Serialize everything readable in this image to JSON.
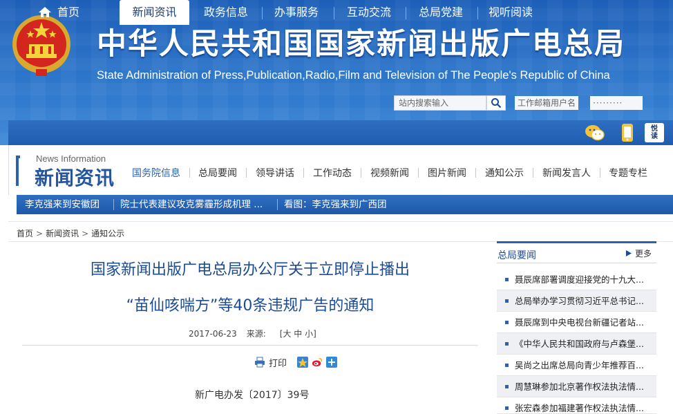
{
  "header": {
    "site_title": "中华人民共和国国家新闻出版广电总局",
    "site_subtitle": "State Administration of Press,Publication,Radio,Film and Television of The People's Republic of China",
    "search_placeholder": "站内搜索输入",
    "username_placeholder": "工作邮箱用户名",
    "password_value": "·········",
    "brand_color": "#2a62b0"
  },
  "nav": {
    "items": [
      "首页",
      "新闻资讯",
      "政务信息",
      "办事服务",
      "互动交流",
      "总局党建",
      "视听阅读"
    ],
    "active": "新闻资讯",
    "icons": [
      "wechat-icon",
      "mobile-icon",
      "yuedu-icon"
    ],
    "yuedu_text": "悦读"
  },
  "section": {
    "en_title": "News Information",
    "cn_title": "新闻资讯",
    "subnav": [
      "国务院信息",
      "总局要闻",
      "领导讲话",
      "工作动态",
      "视频新闻",
      "图片新闻",
      "通知公示",
      "新闻发言人",
      "专题专栏"
    ]
  },
  "ticker": {
    "items": [
      "李克强来到安徽团",
      "院士代表建议攻克雾霾形成机理 ...",
      "看图：李克强来到广西团"
    ]
  },
  "breadcrumb": {
    "items": [
      "首页",
      "新闻资讯",
      "通知公示"
    ],
    "separator": ">"
  },
  "article": {
    "title_line1": "国家新闻出版广电总局办公厅关于立即停止播出",
    "title_line2": "“苗仙咳喘方”等40条违规广告的通知",
    "date": "2017-06-23",
    "source_label": "来源:",
    "size_control": "[大 中 小]",
    "print_label": "打印",
    "doc_number": "新广电办发〔2017〕39号"
  },
  "sidebar": {
    "title": "总局要闻",
    "more_label": "更多",
    "items": [
      "聂辰席部署调度迎接党的十九大...",
      "总局举办学习贯彻习近平总书记...",
      "聂辰席到中央电视台新疆记者站...",
      "《中华人民共和国政府与卢森堡...",
      "吴尚之出席总局向青少年推荐百...",
      "周慧琳参加北京著作权法执法情...",
      "张宏森参加福建著作权法执法情..."
    ]
  }
}
